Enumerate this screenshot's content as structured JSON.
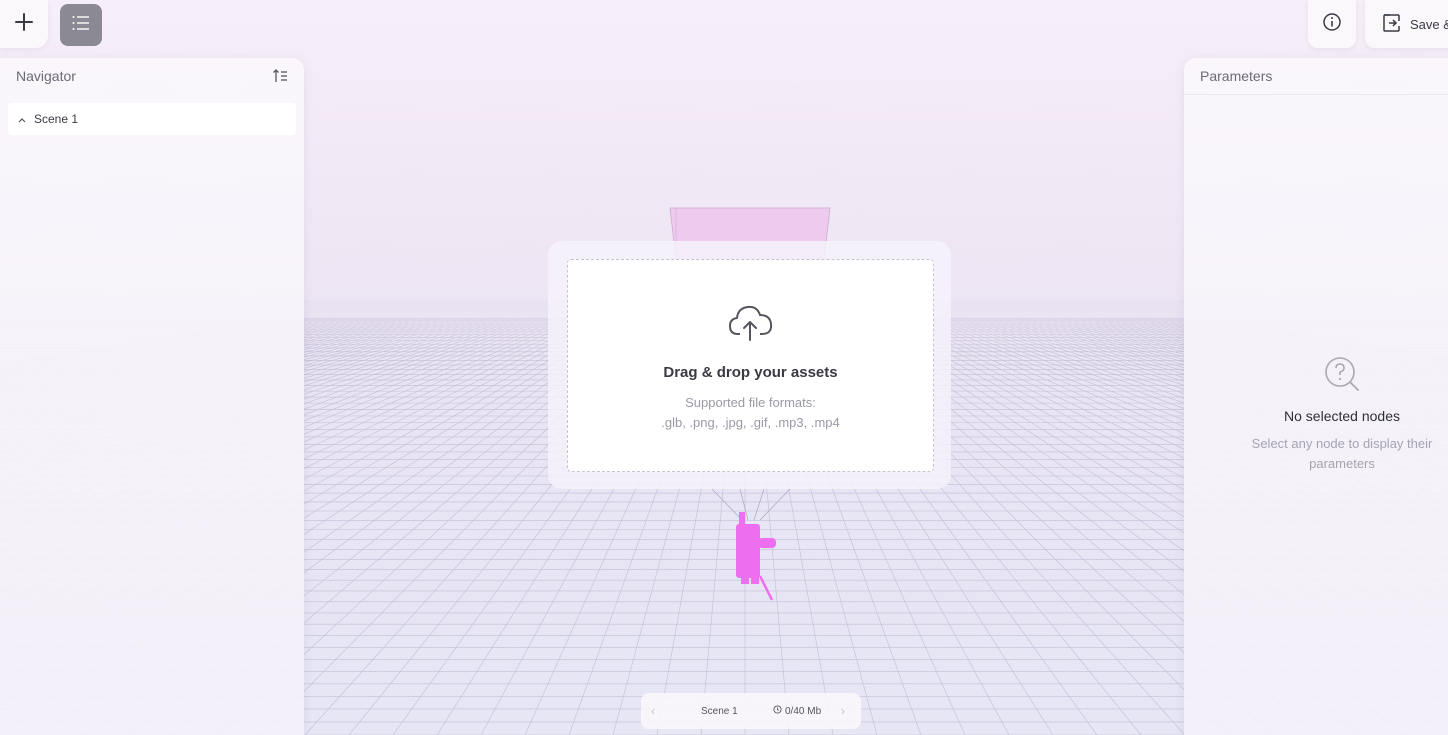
{
  "toolbar": {
    "add_icon": "plus-icon",
    "list_icon": "list-icon",
    "info_icon": "info-icon",
    "save_icon": "exit-icon",
    "save_label": "Save &"
  },
  "navigator": {
    "title": "Navigator",
    "sort_icon": "sort-icon",
    "items": [
      {
        "label": "Scene 1",
        "expanded": true
      }
    ]
  },
  "dropzone": {
    "icon": "cloud-upload-icon",
    "title": "Drag & drop your assets",
    "subtitle_line1": "Supported file formats:",
    "subtitle_line2": ".glb, .png, .jpg, .gif, .mp3, .mp4"
  },
  "parameters": {
    "title": "Parameters",
    "empty_icon": "search-question-icon",
    "empty_title": "No selected nodes",
    "empty_desc_line1": "Select any node to display their",
    "empty_desc_line2": "parameters"
  },
  "statusbar": {
    "prev": "‹",
    "scene": "Scene 1",
    "size": "0/40 Mb",
    "next": "›"
  },
  "colors": {
    "accent_magenta": "#ee6ef0",
    "list_button": "#8b8a94",
    "grid_line": "#b7b2cc"
  }
}
